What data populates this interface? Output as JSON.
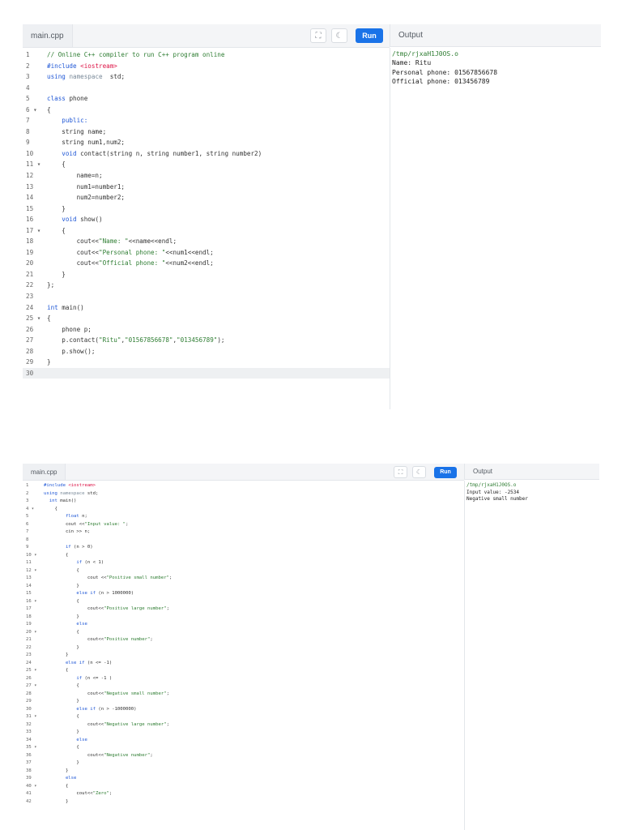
{
  "top": {
    "file_tab": "main.cpp",
    "run_label": "Run",
    "expand_icon": "⛶",
    "theme_icon": "☾",
    "output_label": "Output",
    "output_lines": [
      {
        "text": "/tmp/rjxaH1J0OS.o",
        "kind": "path"
      },
      {
        "text": "Name: Ritu",
        "kind": "out"
      },
      {
        "text": "Personal phone: 01567856678",
        "kind": "out"
      },
      {
        "text": "Official phone: 013456789",
        "kind": "out"
      }
    ],
    "code": [
      {
        "n": "1",
        "t": [
          [
            "cmt",
            "// Online C++ compiler to run C++ program online"
          ]
        ]
      },
      {
        "n": "2",
        "t": [
          [
            "kw",
            "#include "
          ],
          [
            "inc",
            "<iostream>"
          ]
        ]
      },
      {
        "n": "3",
        "t": [
          [
            "kw",
            "using "
          ],
          [
            "cmt2",
            "namespace"
          ],
          [
            "",
            "  std;"
          ]
        ]
      },
      {
        "n": "4",
        "t": []
      },
      {
        "n": "5",
        "t": [
          [
            "kw",
            "class "
          ],
          [
            "",
            "phone"
          ]
        ]
      },
      {
        "n": "6 ▾",
        "t": [
          [
            "",
            "{"
          ]
        ]
      },
      {
        "n": "7",
        "t": [
          [
            "kw",
            "    public:"
          ]
        ]
      },
      {
        "n": "8",
        "t": [
          [
            "",
            "    string name;"
          ]
        ]
      },
      {
        "n": "9",
        "t": [
          [
            "",
            "    string num1,num2;"
          ]
        ]
      },
      {
        "n": "10",
        "t": [
          [
            "kw",
            "    void "
          ],
          [
            "",
            "contact(string n, string number1, string number2)"
          ]
        ]
      },
      {
        "n": "11 ▾",
        "t": [
          [
            "",
            "    {"
          ]
        ]
      },
      {
        "n": "12",
        "t": [
          [
            "",
            "        name=n;"
          ]
        ]
      },
      {
        "n": "13",
        "t": [
          [
            "",
            "        num1=number1;"
          ]
        ]
      },
      {
        "n": "14",
        "t": [
          [
            "",
            "        num2=number2;"
          ]
        ]
      },
      {
        "n": "15",
        "t": [
          [
            "",
            "    }"
          ]
        ]
      },
      {
        "n": "16",
        "t": [
          [
            "kw",
            "    void "
          ],
          [
            "",
            "show()"
          ]
        ]
      },
      {
        "n": "17 ▾",
        "t": [
          [
            "",
            "    {"
          ]
        ]
      },
      {
        "n": "18",
        "t": [
          [
            "",
            "        cout<<"
          ],
          [
            "str",
            "\"Name: \""
          ],
          [
            "",
            "<<name<<endl;"
          ]
        ]
      },
      {
        "n": "19",
        "t": [
          [
            "",
            "        cout<<"
          ],
          [
            "str",
            "\"Personal phone: \""
          ],
          [
            "",
            "<<num1<<endl;"
          ]
        ]
      },
      {
        "n": "20",
        "t": [
          [
            "",
            "        cout<<"
          ],
          [
            "str",
            "\"Official phone: \""
          ],
          [
            "",
            "<<num2<<endl;"
          ]
        ]
      },
      {
        "n": "21",
        "t": [
          [
            "",
            "    }"
          ]
        ]
      },
      {
        "n": "22",
        "t": [
          [
            "",
            "};"
          ]
        ]
      },
      {
        "n": "23",
        "t": []
      },
      {
        "n": "24",
        "t": [
          [
            "kw",
            "int "
          ],
          [
            "",
            "main()"
          ]
        ]
      },
      {
        "n": "25 ▾",
        "t": [
          [
            "",
            "{"
          ]
        ]
      },
      {
        "n": "26",
        "t": [
          [
            "",
            "    phone p;"
          ]
        ]
      },
      {
        "n": "27",
        "t": [
          [
            "",
            "    p.contact("
          ],
          [
            "str",
            "\"Ritu\""
          ],
          [
            "",
            ","
          ],
          [
            "str",
            "\"01567856678\""
          ],
          [
            "",
            ","
          ],
          [
            "str",
            "\"013456789\""
          ],
          [
            "",
            ");"
          ]
        ]
      },
      {
        "n": "28",
        "t": [
          [
            "",
            "    p.show();"
          ]
        ]
      },
      {
        "n": "29",
        "t": [
          [
            "",
            "}"
          ]
        ]
      },
      {
        "n": "30",
        "t": [],
        "current": true
      }
    ]
  },
  "bottom": {
    "file_tab": "main.cpp",
    "run_label": "Run",
    "expand_icon": "⛶",
    "theme_icon": "☾",
    "output_label": "Output",
    "output_lines": [
      {
        "text": "/tmp/rjxaH1J0OS.o",
        "kind": "path"
      },
      {
        "text": "Input value: -2534",
        "kind": "out"
      },
      {
        "text": "Negative small number",
        "kind": "out"
      }
    ],
    "code": [
      {
        "n": "1",
        "t": [
          [
            "kw",
            "#include "
          ],
          [
            "inc",
            "<iostream>"
          ]
        ]
      },
      {
        "n": "2",
        "t": [
          [
            "kw",
            "using "
          ],
          [
            "cmt2",
            "namespace"
          ],
          [
            "",
            " std;"
          ]
        ]
      },
      {
        "n": "3",
        "t": [
          [
            "kw",
            "  int "
          ],
          [
            "",
            "main()"
          ]
        ]
      },
      {
        "n": "4 ▾",
        "t": [
          [
            "",
            "    {"
          ]
        ]
      },
      {
        "n": "5",
        "t": [
          [
            "kw",
            "        float "
          ],
          [
            "",
            "n;"
          ]
        ]
      },
      {
        "n": "6",
        "t": [
          [
            "",
            "        cout <<"
          ],
          [
            "str",
            "\"Input value: \""
          ],
          [
            "",
            ";"
          ]
        ]
      },
      {
        "n": "7",
        "t": [
          [
            "",
            "        cin >> n;"
          ]
        ]
      },
      {
        "n": "8",
        "t": []
      },
      {
        "n": "9",
        "t": [
          [
            "kw",
            "        if "
          ],
          [
            "",
            "(n > 0)"
          ]
        ]
      },
      {
        "n": "10 ▾",
        "t": [
          [
            "",
            "        {"
          ]
        ]
      },
      {
        "n": "11",
        "t": [
          [
            "kw",
            "            if "
          ],
          [
            "",
            "(n < 1)"
          ]
        ]
      },
      {
        "n": "12 ▾",
        "t": [
          [
            "",
            "            {"
          ]
        ]
      },
      {
        "n": "13",
        "t": [
          [
            "",
            "                cout <<"
          ],
          [
            "str",
            "\"Positive small number\""
          ],
          [
            "",
            ";"
          ]
        ]
      },
      {
        "n": "14",
        "t": [
          [
            "",
            "            }"
          ]
        ]
      },
      {
        "n": "15",
        "t": [
          [
            "kw",
            "            else if "
          ],
          [
            "",
            "(n > 1000000)"
          ]
        ]
      },
      {
        "n": "16 ▾",
        "t": [
          [
            "",
            "            {"
          ]
        ]
      },
      {
        "n": "17",
        "t": [
          [
            "",
            "                cout<<"
          ],
          [
            "str",
            "\"Positive large number\""
          ],
          [
            "",
            ";"
          ]
        ]
      },
      {
        "n": "18",
        "t": [
          [
            "",
            "            }"
          ]
        ]
      },
      {
        "n": "19",
        "t": [
          [
            "kw",
            "            else"
          ]
        ]
      },
      {
        "n": "20 ▾",
        "t": [
          [
            "",
            "            {"
          ]
        ]
      },
      {
        "n": "21",
        "t": [
          [
            "",
            "                cout<<"
          ],
          [
            "str",
            "\"Positive number\""
          ],
          [
            "",
            ";"
          ]
        ]
      },
      {
        "n": "22",
        "t": [
          [
            "",
            "            }"
          ]
        ]
      },
      {
        "n": "23",
        "t": [
          [
            "",
            "        }"
          ]
        ]
      },
      {
        "n": "24",
        "t": [
          [
            "kw",
            "        else if "
          ],
          [
            "",
            "(n <= -1)"
          ]
        ]
      },
      {
        "n": "25 ▾",
        "t": [
          [
            "",
            "        {"
          ]
        ]
      },
      {
        "n": "26",
        "t": [
          [
            "kw",
            "            if "
          ],
          [
            "",
            "(n <= -1 )"
          ]
        ]
      },
      {
        "n": "27 ▾",
        "t": [
          [
            "",
            "            {"
          ]
        ]
      },
      {
        "n": "28",
        "t": [
          [
            "",
            "                cout<<"
          ],
          [
            "str",
            "\"Negative small number\""
          ],
          [
            "",
            ";"
          ]
        ]
      },
      {
        "n": "29",
        "t": [
          [
            "",
            "            }"
          ]
        ]
      },
      {
        "n": "30",
        "t": [
          [
            "kw",
            "            else if "
          ],
          [
            "",
            "(n > -1000000)"
          ]
        ]
      },
      {
        "n": "31 ▾",
        "t": [
          [
            "",
            "            {"
          ]
        ]
      },
      {
        "n": "32",
        "t": [
          [
            "",
            "                cout<<"
          ],
          [
            "str",
            "\"Negative large number\""
          ],
          [
            "",
            ";"
          ]
        ]
      },
      {
        "n": "33",
        "t": [
          [
            "",
            "            }"
          ]
        ]
      },
      {
        "n": "34",
        "t": [
          [
            "kw",
            "            else"
          ]
        ]
      },
      {
        "n": "35 ▾",
        "t": [
          [
            "",
            "            {"
          ]
        ]
      },
      {
        "n": "36",
        "t": [
          [
            "",
            "                cout<<"
          ],
          [
            "str",
            "\"Negative number\""
          ],
          [
            "",
            ";"
          ]
        ]
      },
      {
        "n": "37",
        "t": [
          [
            "",
            "            }"
          ]
        ]
      },
      {
        "n": "38",
        "t": [
          [
            "",
            "        }"
          ]
        ]
      },
      {
        "n": "39",
        "t": [
          [
            "kw",
            "        else"
          ]
        ]
      },
      {
        "n": "40 ▾",
        "t": [
          [
            "",
            "        {"
          ]
        ]
      },
      {
        "n": "41",
        "t": [
          [
            "",
            "            cout<<"
          ],
          [
            "str",
            "\"Zero\""
          ],
          [
            "",
            ";"
          ]
        ]
      },
      {
        "n": "42",
        "t": [
          [
            "",
            "        }"
          ]
        ]
      }
    ]
  }
}
